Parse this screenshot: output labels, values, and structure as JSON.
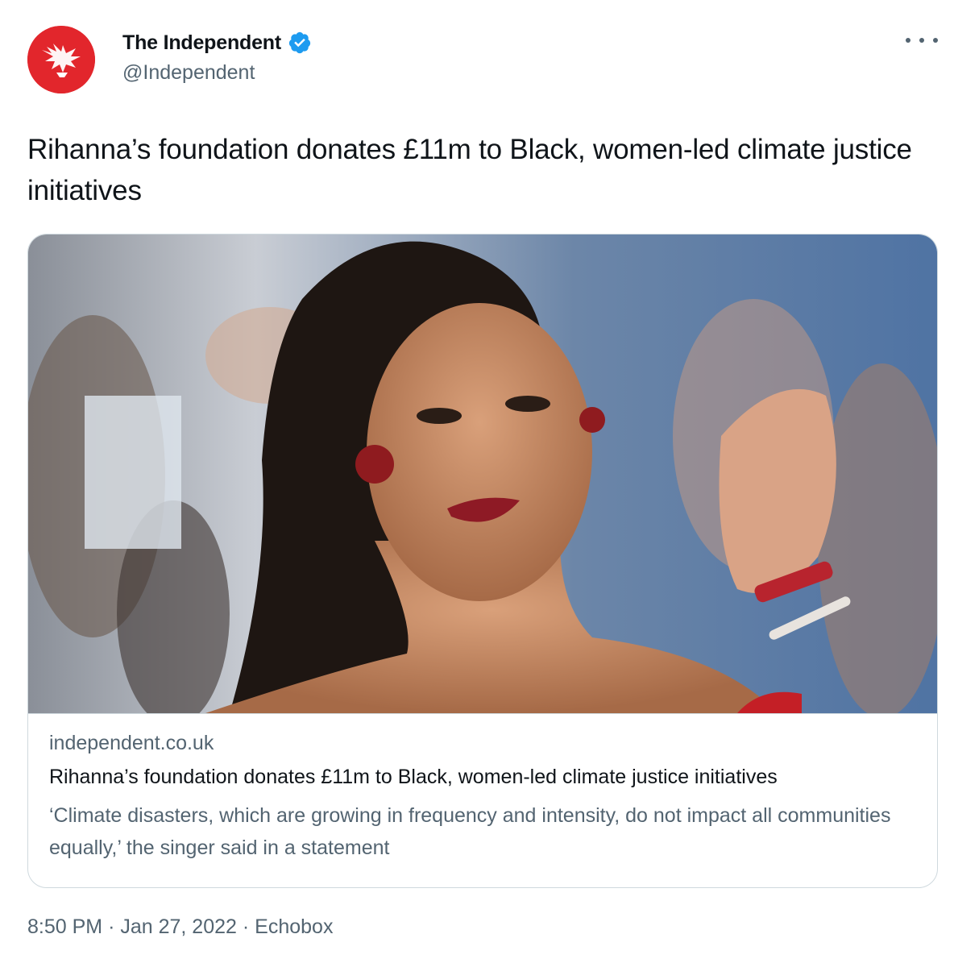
{
  "author": {
    "display_name": "The Independent",
    "handle": "@Independent",
    "verified": true,
    "avatar_icon": "eagle-logo-icon",
    "avatar_color": "#e2262c"
  },
  "tweet": {
    "text": "Rihanna’s foundation donates £11m to Black, women-led climate justice initiatives"
  },
  "card": {
    "image_icon": "article-photo",
    "domain": "independent.co.uk",
    "title": "Rihanna’s foundation donates £11m to Black, women-led climate justice initiatives",
    "description": "‘Climate disasters, which are growing in frequency and intensity, do not impact all communities equally,’ the singer said in a statement"
  },
  "meta": {
    "time": "8:50 PM",
    "separator": "·",
    "date": "Jan 27, 2022",
    "source": "Echobox"
  },
  "colors": {
    "text_primary": "#0f1419",
    "text_secondary": "#536471",
    "verified_blue": "#1d9bf0",
    "border": "#cfd9de"
  }
}
